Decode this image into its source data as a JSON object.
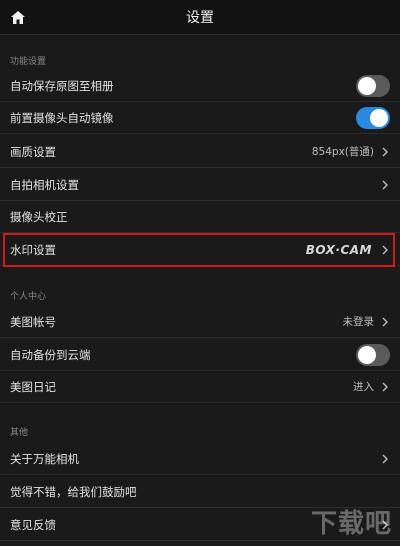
{
  "header": {
    "title": "设置",
    "home_icon": "home-icon"
  },
  "sections": {
    "function": {
      "label": "功能设置"
    },
    "personal": {
      "label": "个人中心"
    },
    "other": {
      "label": "其他"
    }
  },
  "rows": {
    "auto_save": {
      "label": "自动保存原图至相册",
      "toggle": "off"
    },
    "front_mirror": {
      "label": "前置摄像头自动镜像",
      "toggle": "on"
    },
    "quality": {
      "label": "画质设置",
      "value": "854px(普通)"
    },
    "selfie_settings": {
      "label": "自拍相机设置"
    },
    "calibration": {
      "label": "摄像头校正"
    },
    "watermark": {
      "label": "水印设置",
      "logo_text": "BOX·CAM"
    },
    "account": {
      "label": "美图帐号",
      "value": "未登录"
    },
    "cloud_backup": {
      "label": "自动备份到云端",
      "toggle": "off"
    },
    "diary": {
      "label": "美图日记",
      "value": "进入"
    },
    "about": {
      "label": "关于万能相机"
    },
    "encourage": {
      "label": "觉得不错，给我们鼓励吧"
    },
    "feedback": {
      "label": "意见反馈"
    }
  },
  "colors": {
    "background": "#1a1a1a",
    "header": "#121212",
    "toggle_on": "#2a8ae0",
    "toggle_off": "#5a5a5a",
    "highlight": "#d11a1a"
  },
  "site_watermark": "下载吧"
}
